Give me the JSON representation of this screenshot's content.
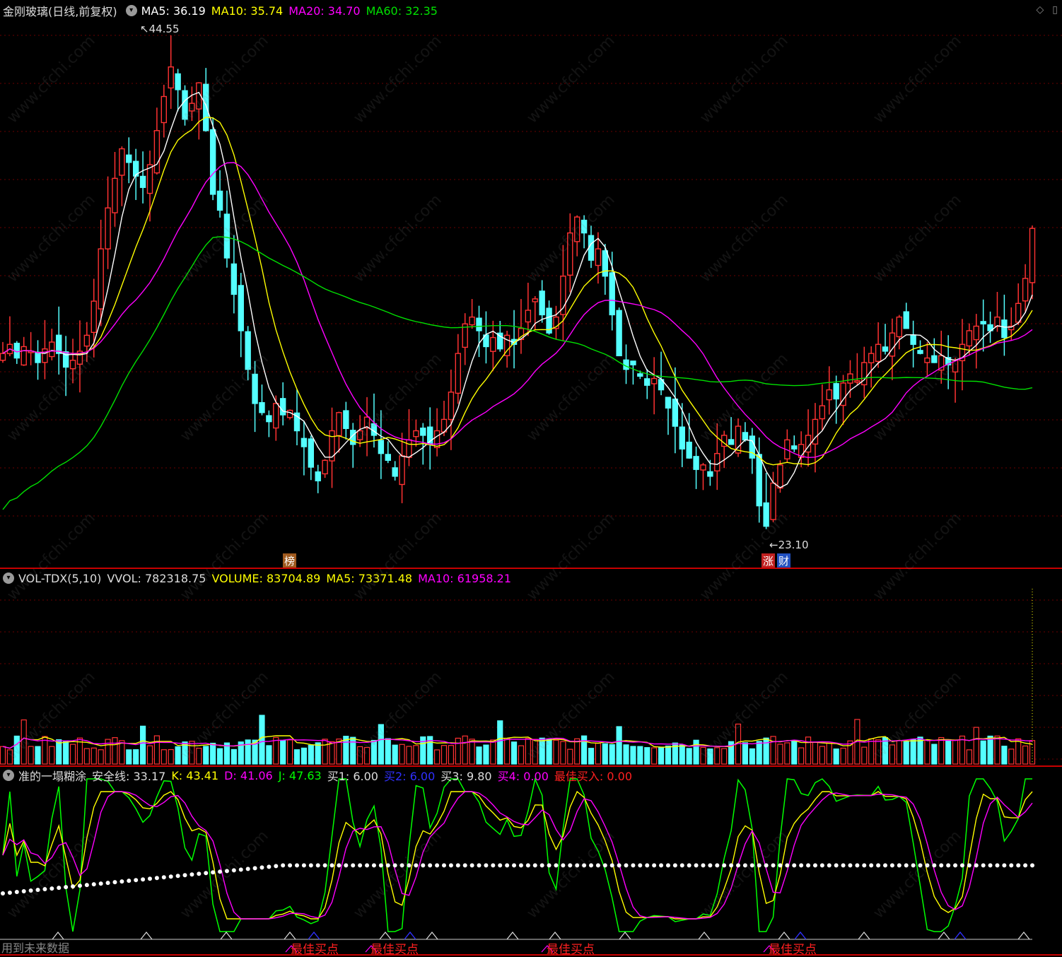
{
  "main": {
    "title": "金刚玻璃(日线,前复权)",
    "ma5": "MA5: 36.19",
    "ma10": "MA10: 35.74",
    "ma20": "MA20: 34.70",
    "ma60": "MA60: 32.35",
    "high_label": "44.55",
    "low_label": "23.10",
    "tag_bang": "榜",
    "tag_zhang": "涨",
    "tag_cai": "财"
  },
  "vol": {
    "name": "VOL-TDX(5,10)",
    "vvol": "VVOL: 782318.75",
    "volume": "VOLUME: 83704.89",
    "ma5": "MA5: 73371.48",
    "ma10": "MA10: 61958.21"
  },
  "kdj": {
    "name": "准的一塌糊涂",
    "safe": "安全线: 33.17",
    "k": "K: 43.41",
    "d": "D: 41.06",
    "j": "J: 47.63",
    "buy1": "买1: 6.00",
    "buy2": "买2: 6.00",
    "buy3": "买3: 9.80",
    "buy4": "买4: 0.00",
    "best": "最佳买入: 0.00",
    "best_point_label": "最佳买点"
  },
  "footer": "用到未来数据",
  "watermark": "www.cfchi.com",
  "colors": {
    "up": "#ff3232",
    "down": "#54ffff",
    "ma5": "#ffffff",
    "ma10": "#ffff00",
    "ma20": "#ff00ff",
    "ma60": "#00e000",
    "k": "#ffff00",
    "d": "#ff00ff",
    "j": "#00ff00",
    "safe": "#ffffff",
    "buy2": "#3030ff",
    "best": "#ff2020"
  },
  "chart_data": {
    "type": "candlestick",
    "y_high": 44.55,
    "y_low": 23.1,
    "closes": [
      31.2,
      31.6,
      31.0,
      31.5,
      31.3,
      30.8,
      31.4,
      31.7,
      31.2,
      30.6,
      30.9,
      31.3,
      32.0,
      33.5,
      35.8,
      37.6,
      38.9,
      40.2,
      39.6,
      39.0,
      38.5,
      39.5,
      41.0,
      42.5,
      43.8,
      42.8,
      41.5,
      42.2,
      43.1,
      41.0,
      38.2,
      37.5,
      35.4,
      33.8,
      32.2,
      30.5,
      29.0,
      28.6,
      28.2,
      29.0,
      28.5,
      28.7,
      27.8,
      27.1,
      26.2,
      25.6,
      26.5,
      27.8,
      28.6,
      27.9,
      27.2,
      27.8,
      28.4,
      27.6,
      26.8,
      26.5,
      25.8,
      26.7,
      27.4,
      27.8,
      27.6,
      27.2,
      27.8,
      28.3,
      29.5,
      31.2,
      32.5,
      32.8,
      32.2,
      31.5,
      31.9,
      31.4,
      32.0,
      31.6,
      32.3,
      33.1,
      33.6,
      32.9,
      32.1,
      32.8,
      34.6,
      36.5,
      37.2,
      36.5,
      35.3,
      35.8,
      34.6,
      32.9,
      31.1,
      30.5,
      30.7,
      30.2,
      29.8,
      30.1,
      29.6,
      28.8,
      28.0,
      27.0,
      26.6,
      26.1,
      26.3,
      25.8,
      26.8,
      27.6,
      27.2,
      28.0,
      27.4,
      26.6,
      24.5,
      23.6,
      25.5,
      26.3,
      27.4,
      27.0,
      27.2,
      27.6,
      28.3,
      28.9,
      29.6,
      29.2,
      29.9,
      30.3,
      30.0,
      30.8,
      31.2,
      31.6,
      31.3,
      32.1,
      32.8,
      32.3,
      31.6,
      31.2,
      31.0,
      30.8,
      31.1,
      30.7,
      30.9,
      31.6,
      32.2,
      32.4,
      32.5,
      32.2,
      32.8,
      31.9,
      32.4,
      33.4,
      34.5,
      36.7
    ],
    "ma5": "white line",
    "ma10": "yellow line",
    "ma20": "magenta line",
    "ma60": "green line",
    "kdj_series": [
      "K",
      "D",
      "J",
      "安全线"
    ],
    "volume_unit": "lots"
  }
}
